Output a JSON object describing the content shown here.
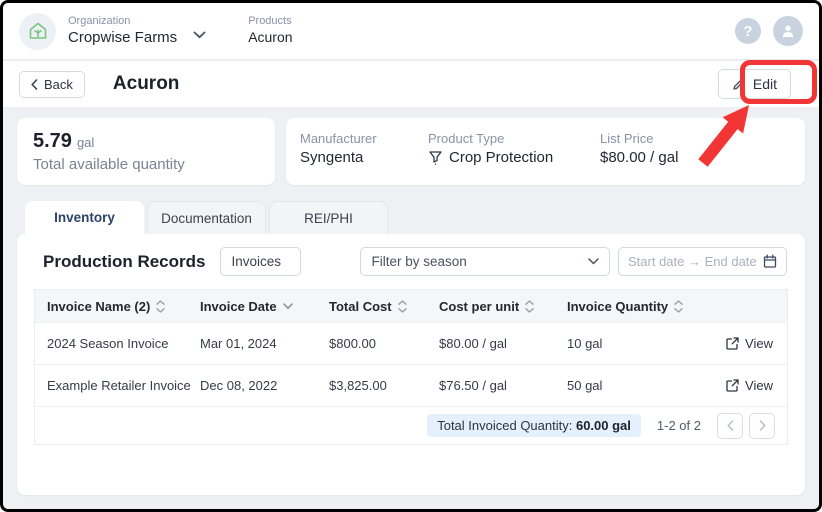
{
  "header": {
    "org_label": "Organization",
    "org_name": "Cropwise Farms",
    "products_label": "Products",
    "product_name": "Acuron"
  },
  "title_bar": {
    "back_label": "Back",
    "title": "Acuron",
    "edit_label": "Edit"
  },
  "summary": {
    "quantity_value": "5.79",
    "quantity_unit": "gal",
    "quantity_caption": "Total available quantity",
    "manufacturer_label": "Manufacturer",
    "manufacturer": "Syngenta",
    "product_type_label": "Product Type",
    "product_type": "Crop Protection",
    "list_price_label": "List Price",
    "list_price": "$80.00 / gal"
  },
  "tabs": [
    {
      "label": "Inventory",
      "active": true
    },
    {
      "label": "Documentation",
      "active": false
    },
    {
      "label": "REI/PHI",
      "active": false
    }
  ],
  "records": {
    "heading": "Production Records",
    "type_select_value": "Invoices",
    "season_filter_placeholder": "Filter by season",
    "date_range_placeholder": "Start date → End date"
  },
  "table": {
    "columns": [
      "Invoice Name (2)",
      "Invoice Date",
      "Total Cost",
      "Cost per unit",
      "Invoice Quantity"
    ],
    "rows": [
      {
        "name": "2024 Season Invoice",
        "date": "Mar 01, 2024",
        "total": "$800.00",
        "cost_per_unit": "$80.00 / gal",
        "quantity": "10 gal",
        "action": "View"
      },
      {
        "name": "Example Retailer Invoice",
        "date": "Dec 08, 2022",
        "total": "$3,825.00",
        "cost_per_unit": "$76.50 / gal",
        "quantity": "50 gal",
        "action": "View"
      }
    ],
    "footer": {
      "total_label": "Total Invoiced Quantity: ",
      "total_value": "60.00 gal",
      "range": "1-2 of 2"
    }
  },
  "icons": {
    "logo": "greenhouse-plant",
    "help": "question-mark",
    "avatar": "person",
    "product_type": "funnel",
    "view": "external-link",
    "date": "calendar",
    "edit": "pencil"
  },
  "colors": {
    "annotation_red": "#f23636",
    "badge_blue": "#e4f1fc",
    "logo_green": "#7cc47f",
    "page_background": "#eef0f3"
  }
}
